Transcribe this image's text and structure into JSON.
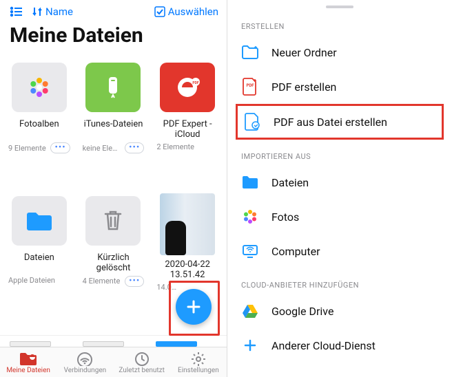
{
  "header": {
    "sort_label": "Name",
    "select_label": "Auswählen"
  },
  "title": "Meine Dateien",
  "tiles": [
    {
      "label": "Fotoalben",
      "meta": "9 Elemente"
    },
    {
      "label": "iTunes-Dateien",
      "meta": "keine Ele…"
    },
    {
      "label": "PDF Expert - iCloud",
      "meta": "2 Elemente"
    },
    {
      "label": "Dateien",
      "meta": "Apple Dateien"
    },
    {
      "label": "Kürzlich gelöscht",
      "meta": "4 Elemente"
    },
    {
      "label": "2020-04-22 13.51.42",
      "meta": "14.0…"
    }
  ],
  "bottombar": {
    "my_files": "Meine Dateien",
    "connections": "Verbindungen",
    "recent": "Zuletzt benutzt",
    "settings": "Einstellungen"
  },
  "right": {
    "section_create": "ERSTELLEN",
    "new_folder": "Neuer Ordner",
    "pdf_create": "PDF erstellen",
    "pdf_from_file": "PDF aus Datei erstellen",
    "section_import": "IMPORTIEREN AUS",
    "files": "Dateien",
    "photos": "Fotos",
    "computer": "Computer",
    "section_cloud": "CLOUD-ANBIETER HINZUFÜGEN",
    "gdrive": "Google Drive",
    "other_cloud": "Anderer Cloud-Dienst"
  }
}
